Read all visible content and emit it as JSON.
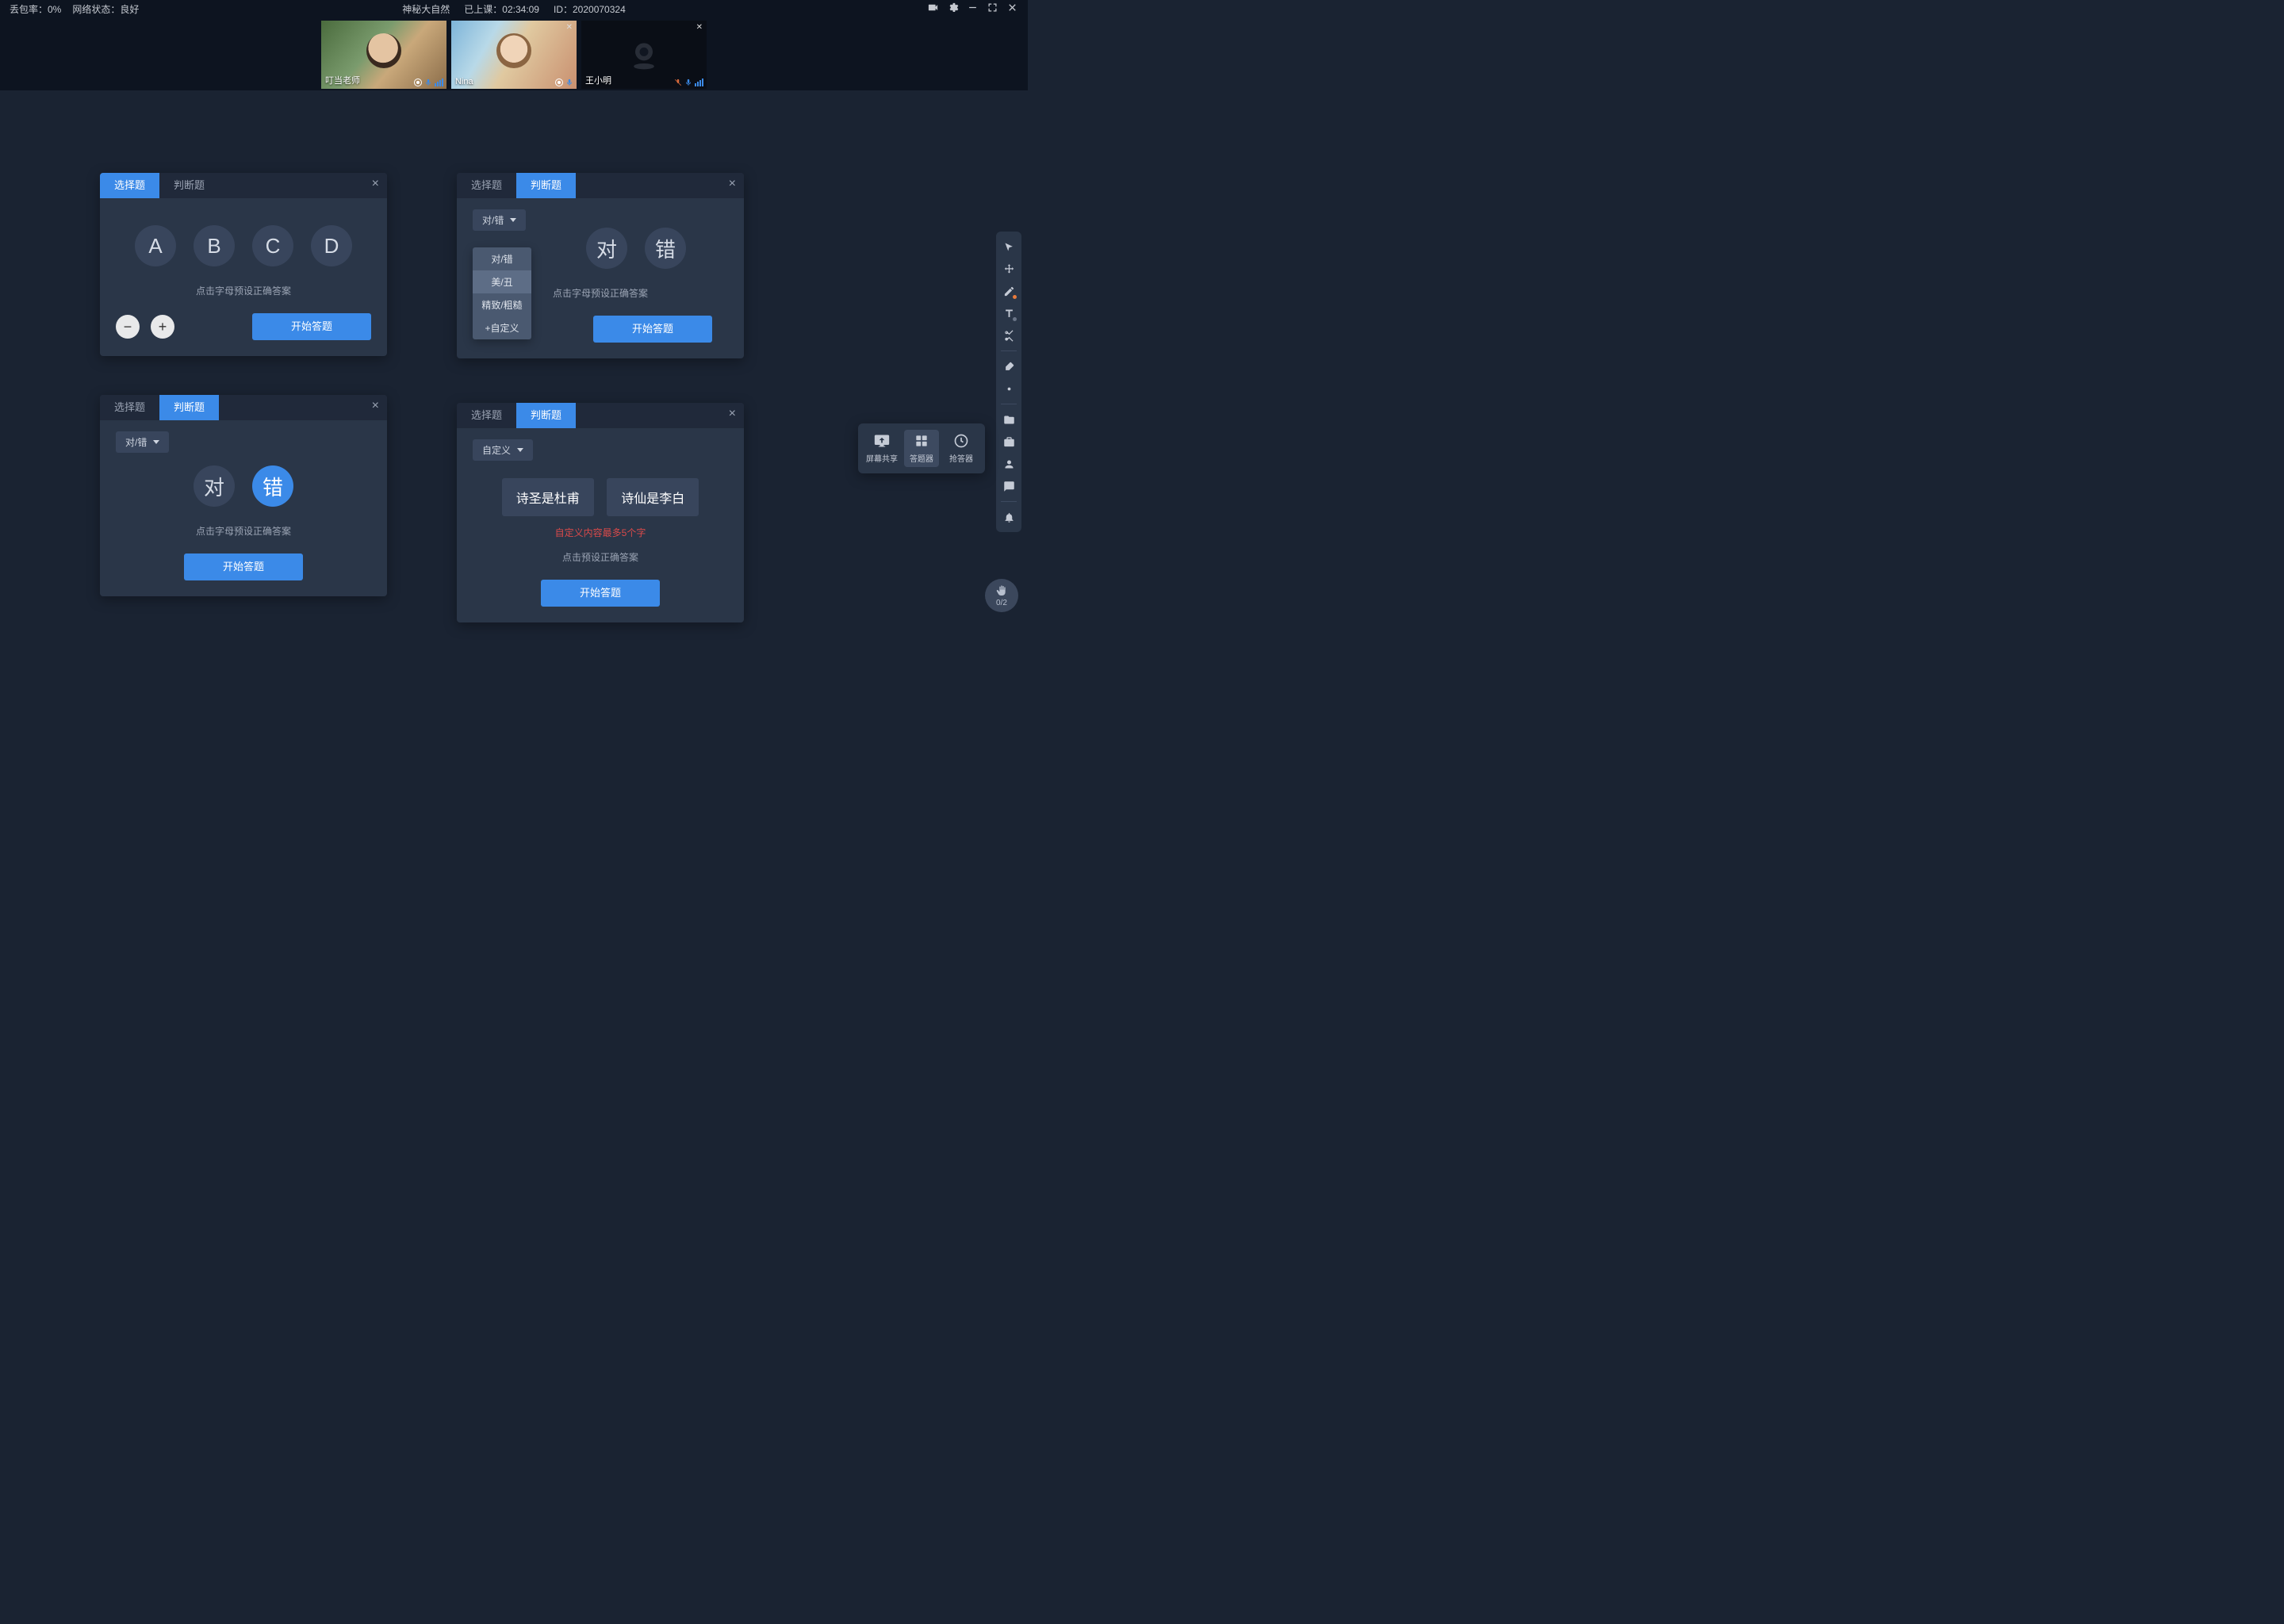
{
  "topbar": {
    "packet_loss_label": "丢包率：0%",
    "network_label": "网络状态：良好",
    "course_name": "神秘大自然",
    "elapsed_label": "已上课：",
    "elapsed_time": "02:34:09",
    "id_label": "ID：",
    "id_value": "2020070324"
  },
  "videos": [
    {
      "name": "叮当老师",
      "camera_off": false
    },
    {
      "name": "Nina",
      "camera_off": false
    },
    {
      "name": "王小明",
      "camera_off": true
    }
  ],
  "tabs": {
    "choice": "选择题",
    "judge": "判断题"
  },
  "panel1": {
    "options": [
      "A",
      "B",
      "C",
      "D"
    ],
    "hint": "点击字母预设正确答案",
    "start": "开始答题"
  },
  "panel2": {
    "dropdown_selected": "对/错",
    "menu": [
      "对/错",
      "美/丑",
      "精致/粗糙",
      "+自定义"
    ],
    "options": [
      "对",
      "错"
    ],
    "hint": "点击字母预设正确答案",
    "start": "开始答题"
  },
  "panel3": {
    "dropdown_selected": "对/错",
    "options": [
      "对",
      "错"
    ],
    "selected_index": 1,
    "hint": "点击字母预设正确答案",
    "start": "开始答题"
  },
  "panel4": {
    "dropdown_selected": "自定义",
    "chips": [
      "诗圣是杜甫",
      "诗仙是李白"
    ],
    "error": "自定义内容最多5个字",
    "hint": "点击预设正确答案",
    "start": "开始答题"
  },
  "bottom_tools": {
    "screen_share": "屏幕共享",
    "answer_device": "答题器",
    "buzz_device": "抢答器"
  },
  "hand": {
    "count": "0/2"
  }
}
